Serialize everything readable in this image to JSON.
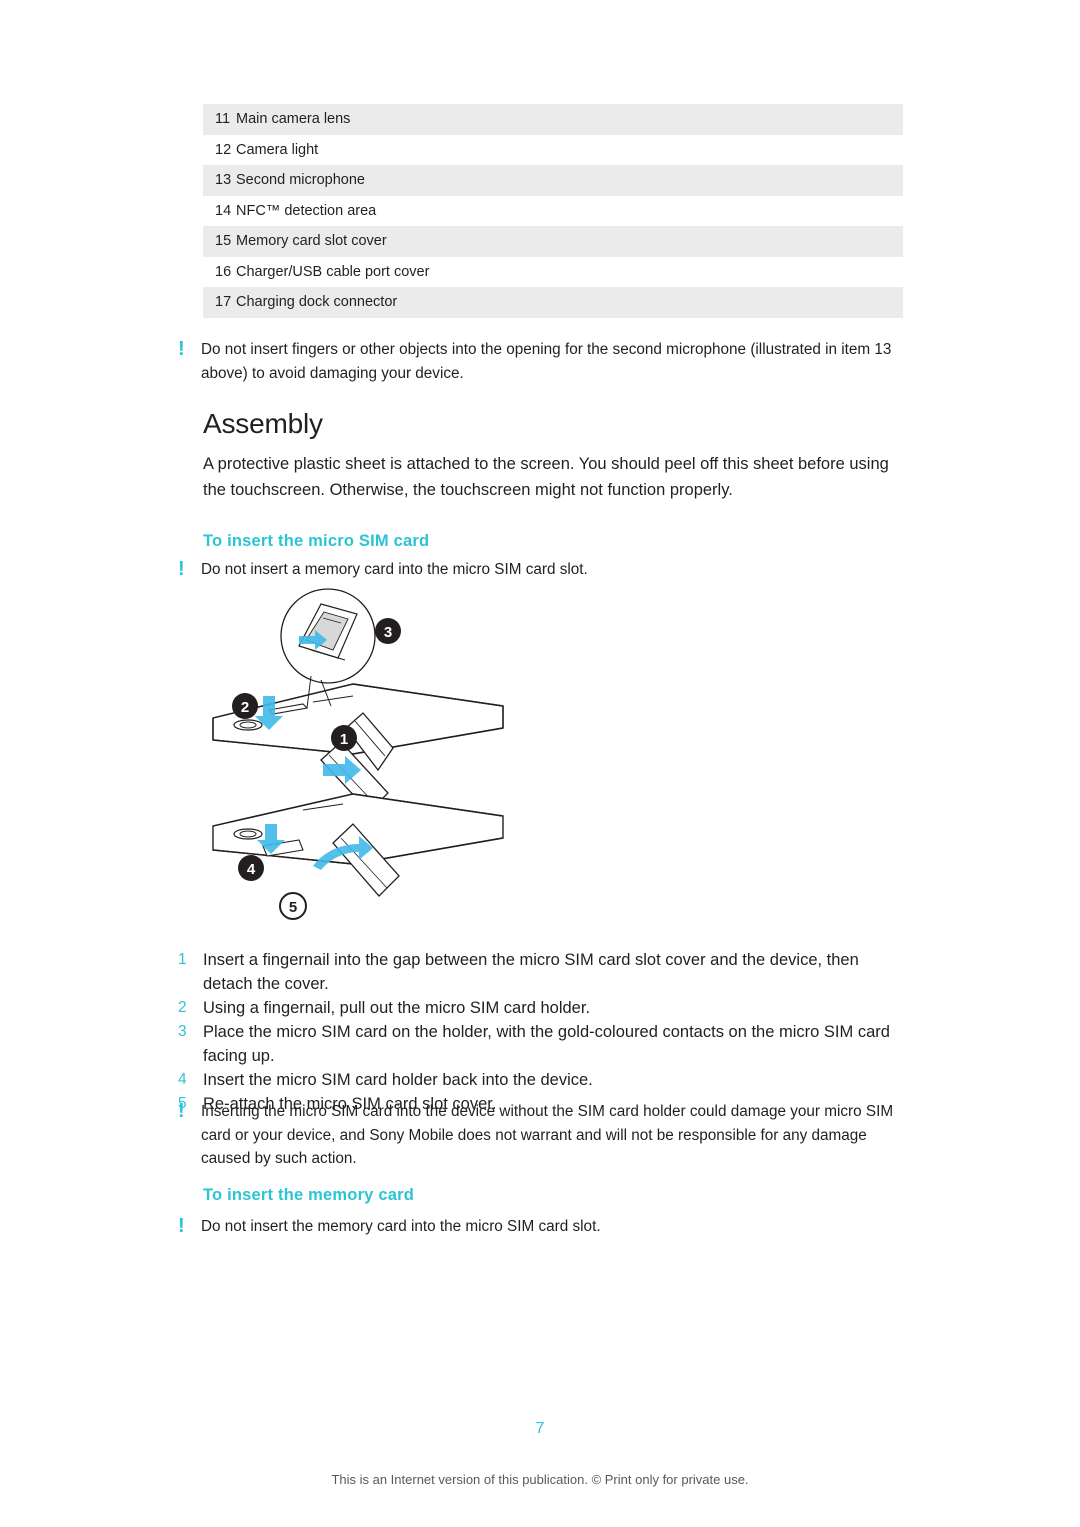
{
  "parts_table": {
    "rows": [
      {
        "num": "11",
        "label": "Main camera lens"
      },
      {
        "num": "12",
        "label": "Camera light"
      },
      {
        "num": "13",
        "label": "Second microphone"
      },
      {
        "num": "14",
        "label": "NFC™ detection area"
      },
      {
        "num": "15",
        "label": "Memory card slot cover"
      },
      {
        "num": "16",
        "label": "Charger/USB cable port cover"
      },
      {
        "num": "17",
        "label": "Charging dock connector"
      }
    ]
  },
  "notes": {
    "mark": "!",
    "note1": "Do not insert fingers or other objects into the opening for the second microphone (illustrated in item 13 above) to avoid damaging your device.",
    "note2": "Do not insert a memory card into the micro SIM card slot.",
    "note3": "Inserting the micro SIM card into the device without the SIM card holder could damage your micro SIM card or your device, and Sony Mobile does not warrant and will not be responsible for any damage caused by such action.",
    "note4": "Do not insert the memory card into the micro SIM card slot."
  },
  "headings": {
    "assembly": "Assembly",
    "insert_sim": "To insert the micro SIM card",
    "insert_memory": "To insert the memory card"
  },
  "body": {
    "intro": "A protective plastic sheet is attached to the screen. You should peel off this sheet before using the touchscreen. Otherwise, the touchscreen might not function properly."
  },
  "steps": [
    {
      "num": "1",
      "text": "Insert a fingernail into the gap between the micro SIM card slot cover and the device, then detach the cover."
    },
    {
      "num": "2",
      "text": "Using a fingernail, pull out the micro SIM card holder."
    },
    {
      "num": "3",
      "text": "Place the micro SIM card on the holder, with the gold-coloured contacts on the micro SIM card facing up."
    },
    {
      "num": "4",
      "text": "Insert the micro SIM card holder back into the device."
    },
    {
      "num": "5",
      "text": "Re-attach the micro SIM card slot cover."
    }
  ],
  "illustration": {
    "callouts": [
      "1",
      "2",
      "3",
      "4",
      "5"
    ],
    "arrow_color": "#3fb9e8",
    "line_color": "#231f20"
  },
  "footer": {
    "page_number": "7",
    "note": "This is an Internet version of this publication. © Print only for private use."
  },
  "colors": {
    "accent": "#2bc4d4",
    "text": "#231f20",
    "table_shade": "#ebebeb",
    "footer_text": "#58595b"
  }
}
